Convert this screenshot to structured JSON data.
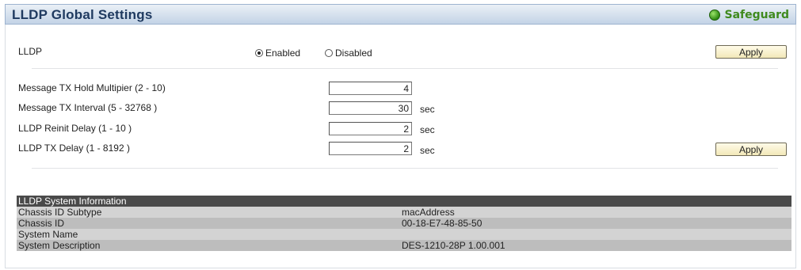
{
  "header": {
    "title": "LLDP Global Settings",
    "badge": "Safeguard",
    "badge_color": "#3f8a1e"
  },
  "lldp_state": {
    "label": "LLDP",
    "options": [
      "Enabled",
      "Disabled"
    ],
    "selected": "Enabled",
    "apply_label": "Apply"
  },
  "settings": {
    "apply_label": "Apply",
    "fields": [
      {
        "label": "Message TX Hold Multipier  (2 - 10)",
        "value": "4",
        "unit": ""
      },
      {
        "label": "Message TX Interval  (5 - 32768 )",
        "value": "30",
        "unit": "sec"
      },
      {
        "label": "LLDP Reinit Delay  (1 - 10 )",
        "value": "2",
        "unit": "sec"
      },
      {
        "label": "LLDP TX Delay  (1 - 8192 )",
        "value": "2",
        "unit": "sec"
      }
    ]
  },
  "system_info": {
    "title": "LLDP System Information",
    "rows": [
      {
        "key": "Chassis ID Subtype",
        "value": "macAddress"
      },
      {
        "key": "Chassis ID",
        "value": "00-18-E7-48-85-50"
      },
      {
        "key": "System Name",
        "value": ""
      },
      {
        "key": "System Description",
        "value": "DES-1210-28P 1.00.001"
      }
    ]
  }
}
